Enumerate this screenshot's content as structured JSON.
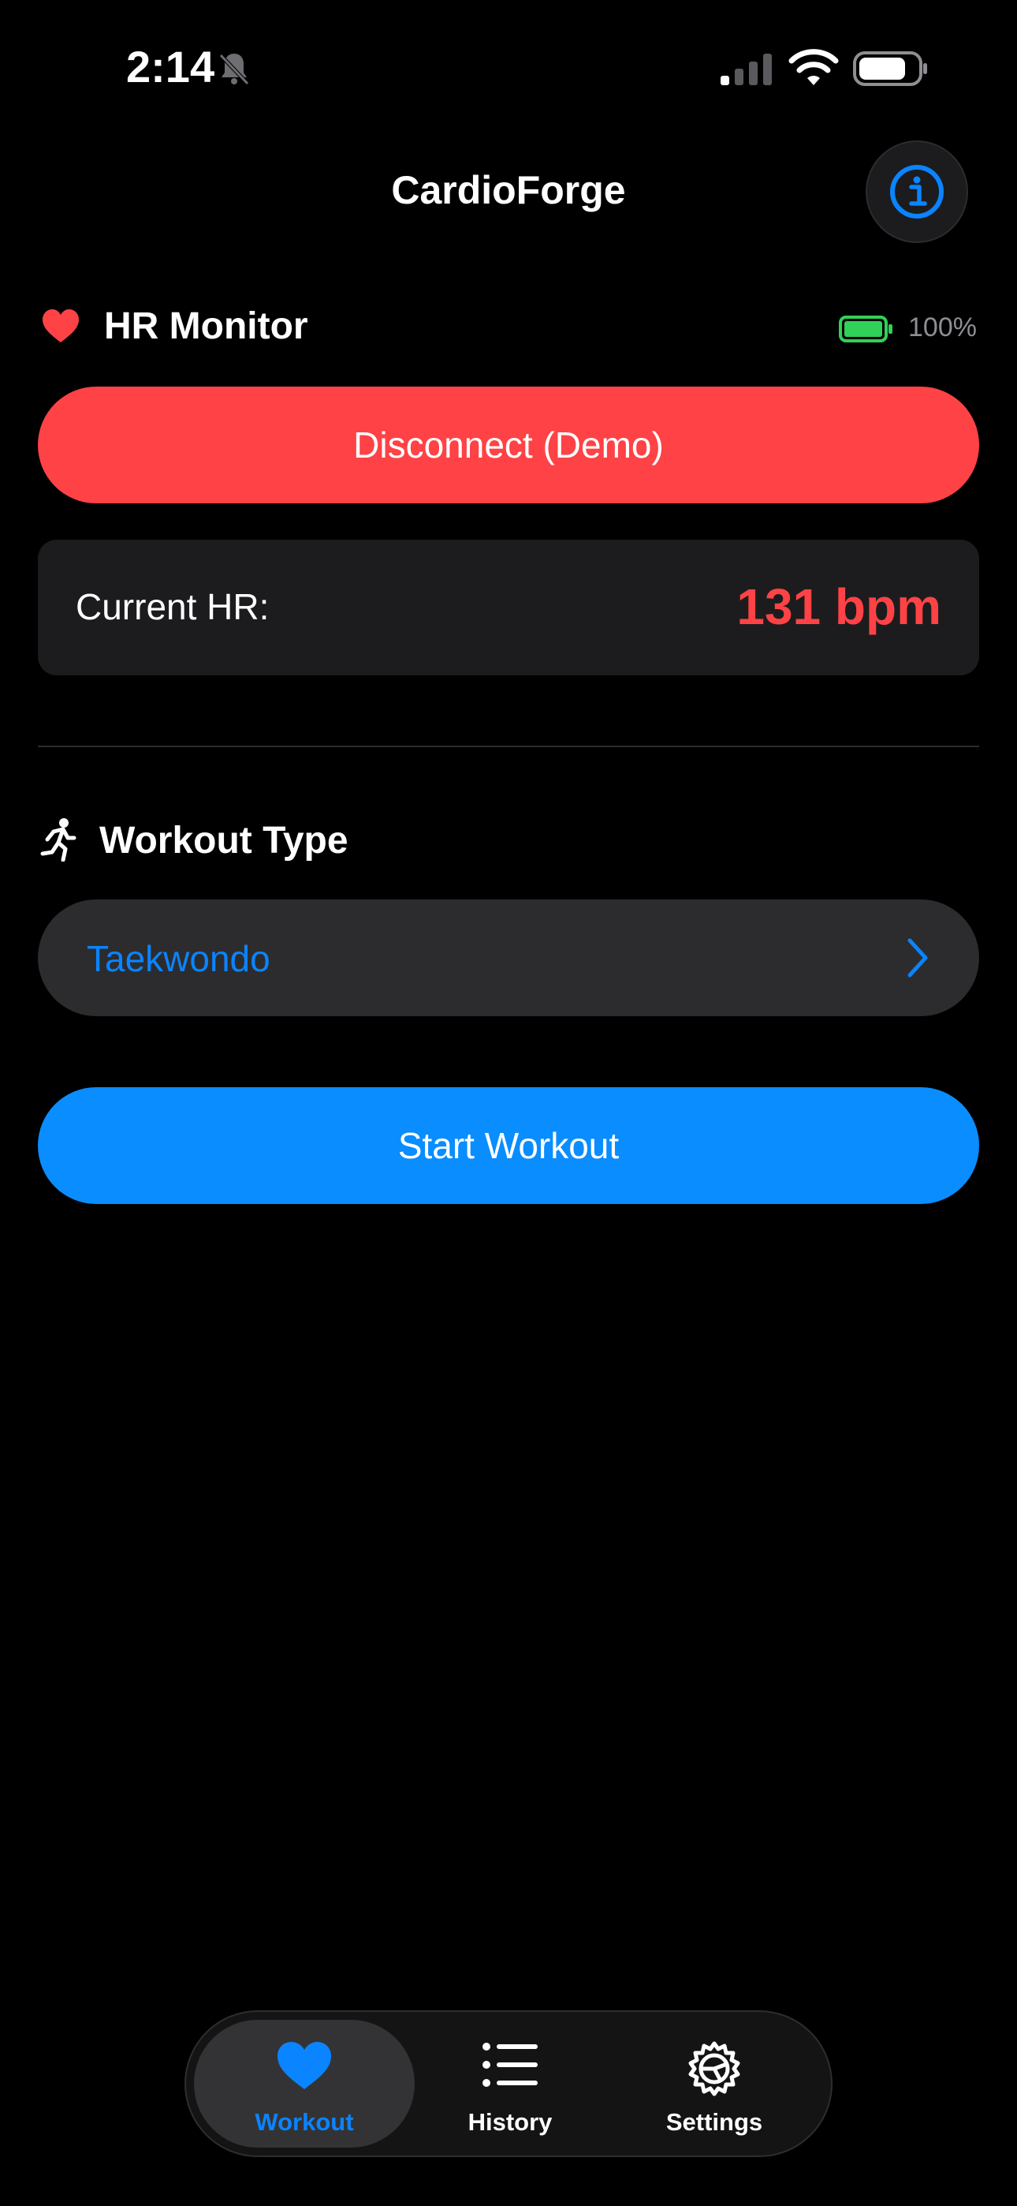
{
  "status_bar": {
    "time": "2:14",
    "icons": [
      "bell-slash-icon",
      "cellular-signal-icon",
      "wifi-icon",
      "battery-icon"
    ]
  },
  "header": {
    "title": "CardioForge",
    "info_icon": "info-circle-icon"
  },
  "hr_monitor": {
    "title": "HR Monitor",
    "icon": "heart-icon",
    "device_battery_label": "100%",
    "device_battery_level": 1.0,
    "disconnect_label": "Disconnect (Demo)",
    "current_hr_label": "Current HR:",
    "current_hr_value": "131 bpm"
  },
  "workout": {
    "title": "Workout Type",
    "icon": "runner-icon",
    "selected_type": "Taekwondo",
    "start_label": "Start Workout"
  },
  "tab_bar": {
    "tabs": [
      {
        "label": "Workout",
        "icon": "heart-icon",
        "active": true
      },
      {
        "label": "History",
        "icon": "list-icon",
        "active": false
      },
      {
        "label": "Settings",
        "icon": "gear-icon",
        "active": false
      }
    ]
  },
  "colors": {
    "background": "#000000",
    "accent_blue": "#0a84ff",
    "accent_red": "#ff4245",
    "card": "#1c1c1e",
    "battery_green": "#30d158",
    "secondary_text": "#8e8e93"
  }
}
